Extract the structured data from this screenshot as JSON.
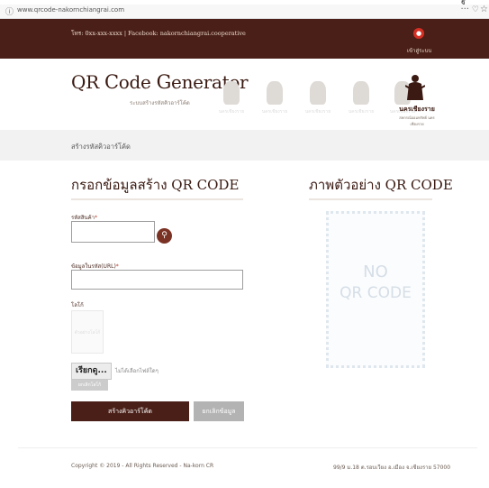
{
  "top_text": "ฐ",
  "browser": {
    "url": "www.qrcode-nakornchiangrai.com",
    "more_glyph": "···"
  },
  "topbar": {
    "contact": "โทร: 0xx-xxx-xxxx | Facebook: nakornchiangrai.cooperative",
    "login_label": "เข้าสู่ระบบ"
  },
  "brand": {
    "title_q": "Q",
    "title_rest1": "R ",
    "title_c": "C",
    "title_rest2": "ode ",
    "title_g": "G",
    "title_rest3": "enerator",
    "subtitle": "ระบบสร้างรหัสคิวอาร์โค้ด",
    "faded_caption": "นครเชียงราย",
    "logo_name": "นครเชียงราย",
    "logo_slogan": "สหกรณ์ออมทรัพย์ นครเชียงราย"
  },
  "breadcrumb": "สร้างรหัสคิวอาร์โค้ด",
  "form": {
    "title": "กรอกข้อมูลสร้าง QR CODE",
    "product_code_label": "รหัสสินค้า",
    "url_label": "ข้อมูลในรหัส(URL)",
    "logo_label": "โลโก้",
    "logo_placeholder": "ตัวอย่างโลโก้",
    "browse_label": "เรียกดู...",
    "no_file": "ไม่ได้เลือกไฟล์ใดๆ",
    "cancel_logo": "ยกเลิกโลโก้",
    "submit_label": "สร้างคิวอาร์โค้ด",
    "reset_label": "ยกเลิกข้อมูล",
    "required_mark": "*"
  },
  "preview": {
    "title": "ภาพตัวอย่าง QR CODE",
    "no_text": "NO",
    "qr_text": "QR CODE"
  },
  "footer": {
    "copyright": "Copyright © 2019 - All Rights Reserved - Na-korn CR",
    "address": "99/9 ม.18 ต.รอบเวียง อ.เมือง จ.เชียงราย 57000"
  },
  "colors": {
    "header_bg": "#4a1f17",
    "primary_button": "#4a1f17",
    "secondary_button": "#b3b3b3",
    "login_icon": "#d63025"
  }
}
